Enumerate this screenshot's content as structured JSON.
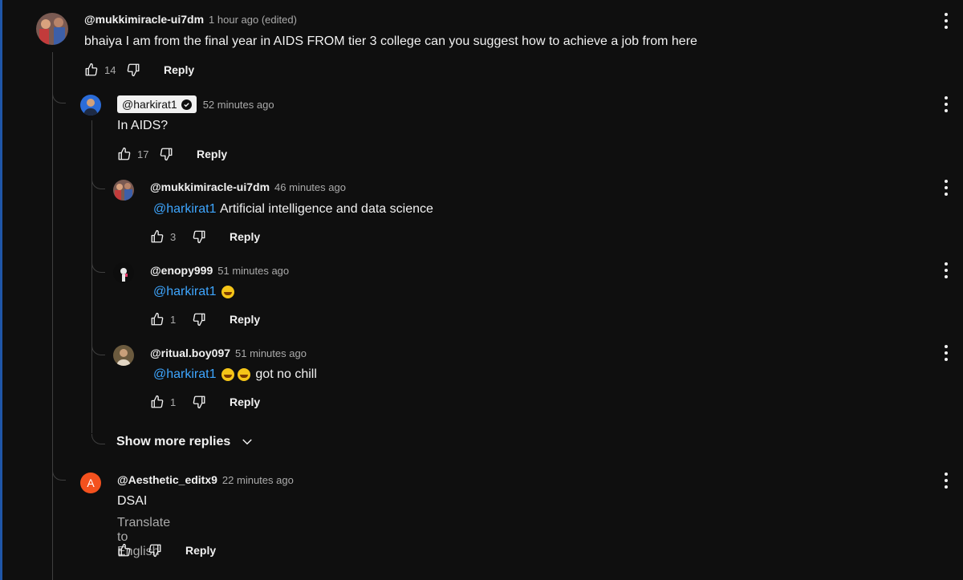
{
  "colors": {
    "background": "#0f0f0f",
    "text": "#f1f1f1",
    "muted": "#aaaaaa",
    "mention": "#3ea6ff",
    "letter_avatar": "#f4511e"
  },
  "icons": {
    "like": "thumbs-up-icon",
    "dislike": "thumbs-down-icon",
    "menu": "three-dots-vertical-icon",
    "verified": "verified-check-icon",
    "expand": "chevron-down-icon"
  },
  "top_comment": {
    "author": "@mukkimiracle-ui7dm",
    "time": "1 hour ago (edited)",
    "text": "bhaiya I am from the final year in AIDS FROM tier 3 college can you suggest how to achieve a job from here",
    "likes": "14",
    "reply_label": "Reply"
  },
  "replies": [
    {
      "author": "@harkirat1",
      "time": "52 minutes ago",
      "text": "In AIDS?",
      "likes": "17",
      "reply_label": "Reply"
    },
    {
      "author": "@mukkimiracle-ui7dm",
      "time": "46 minutes ago",
      "mention": "@harkirat1",
      "text": "Artificial intelligence and data science",
      "likes": "3",
      "reply_label": "Reply"
    },
    {
      "author": "@enopy999",
      "time": "51 minutes ago",
      "mention": "@harkirat1",
      "text": "",
      "likes": "1",
      "reply_label": "Reply"
    },
    {
      "author": "@ritual.boy097",
      "time": "51 minutes ago",
      "mention": "@harkirat1",
      "text": "got no chill",
      "likes": "1",
      "reply_label": "Reply"
    }
  ],
  "show_more_replies": "Show more replies",
  "last_reply": {
    "avatar_letter": "A",
    "author": "@Aesthetic_editx9",
    "time": "22 minutes ago",
    "text": "DSAI",
    "translate": "Translate to English",
    "likes": "",
    "reply_label": "Reply"
  }
}
